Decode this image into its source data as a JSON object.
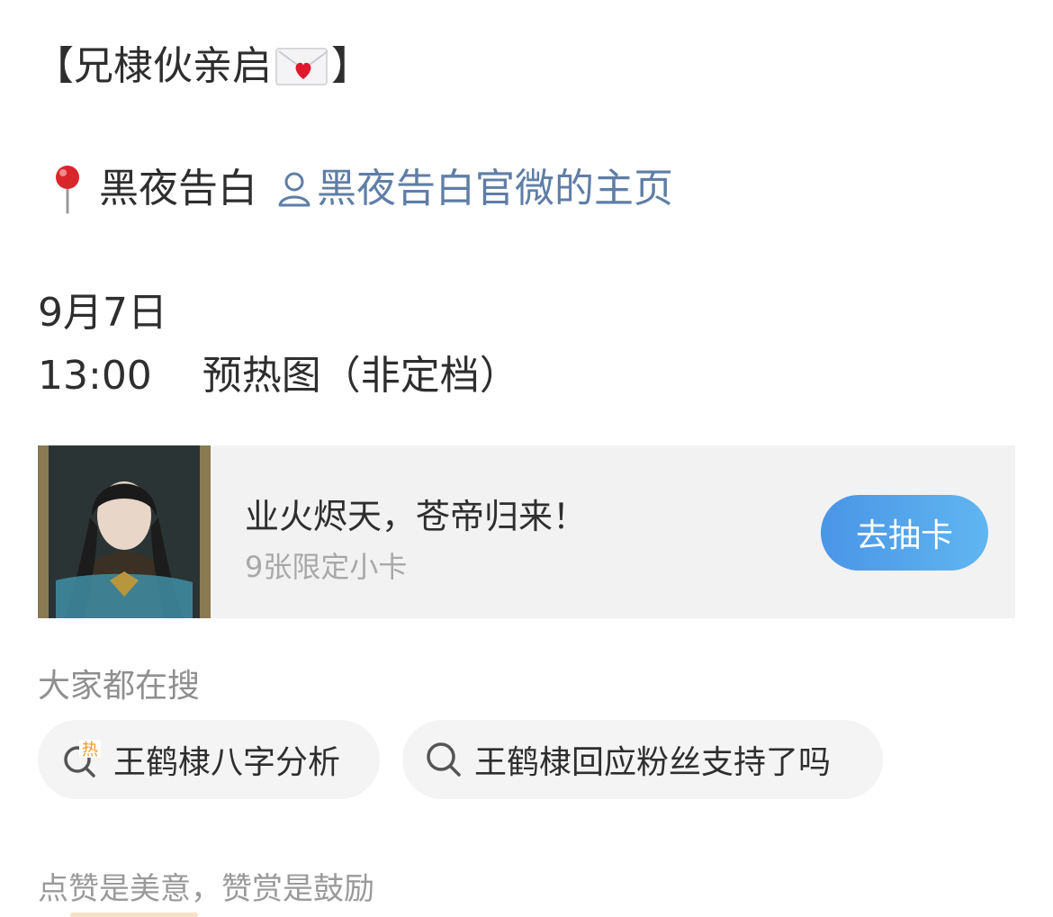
{
  "post": {
    "headline_open": "【兄棣伙亲启",
    "headline_close": "】",
    "headline_icon": "love-letter-envelope-icon",
    "location_icon": "red-pin-icon",
    "location_name": "黑夜告白",
    "link_icon": "person-outline-icon",
    "link_text": "黑夜告白官微的主页",
    "date": "9月7日",
    "time_line": "13:00    预热图（非定档）"
  },
  "card": {
    "title": "业火烬天，苍帝归来！",
    "subtitle": "9张限定小卡",
    "button_label": "去抽卡",
    "thumb": "character-portrait"
  },
  "search": {
    "heading": "大家都在搜",
    "chips": [
      {
        "icon": "hot-search-icon",
        "label": "王鹤棣八字分析"
      },
      {
        "icon": "search-icon",
        "label": "王鹤棣回应粉丝支持了吗"
      }
    ]
  },
  "footer": {
    "text": "点赞是美意，赞赏是鼓励"
  },
  "colors": {
    "link": "#5f7ea6",
    "button_gradient_start": "#4a95e6",
    "button_gradient_end": "#5fb6f0",
    "card_bg": "#f2f2f2",
    "muted": "#a8a8a8",
    "hot_orange": "#f29a2e"
  }
}
